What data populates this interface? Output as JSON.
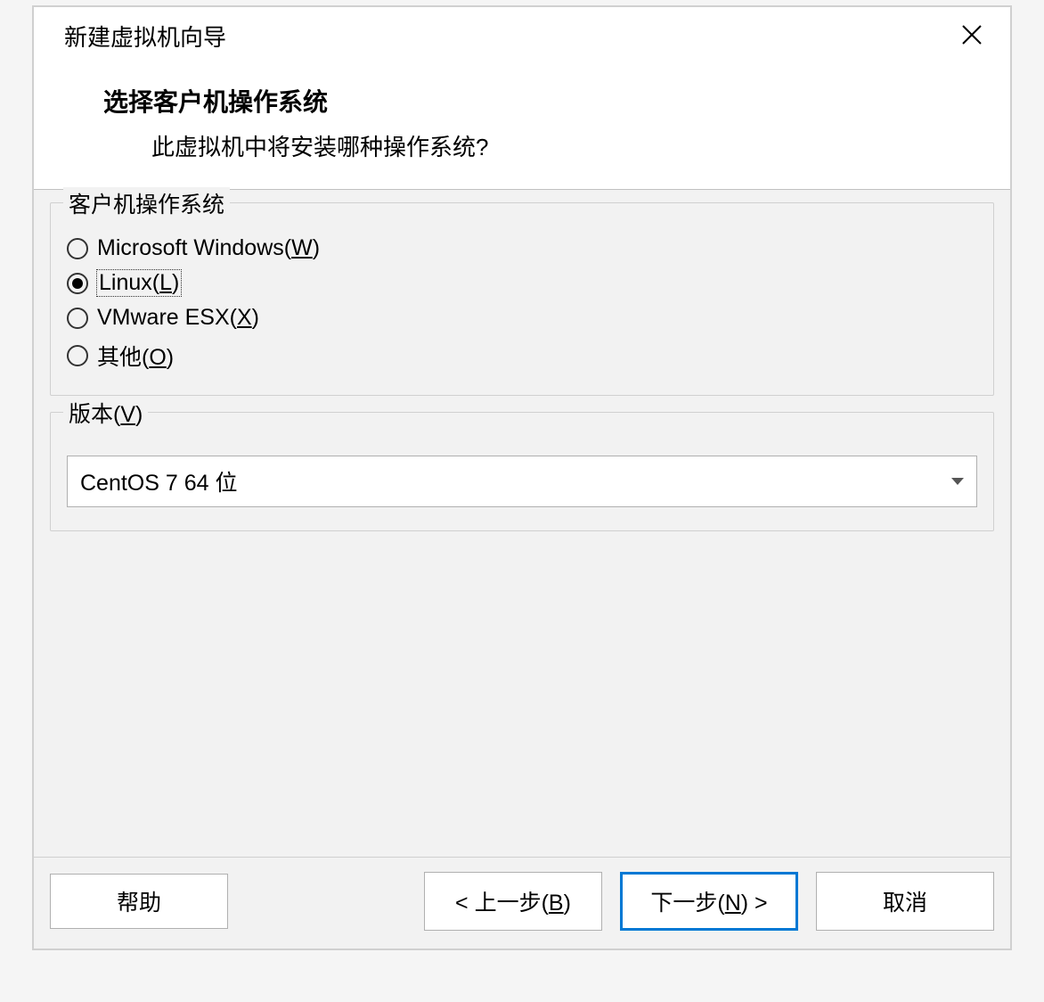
{
  "dialog": {
    "title": "新建虚拟机向导"
  },
  "header": {
    "title": "选择客户机操作系统",
    "subtitle": "此虚拟机中将安装哪种操作系统?"
  },
  "os_group": {
    "legend": "客户机操作系统",
    "options": [
      {
        "prefix": "Microsoft Windows(",
        "key": "W",
        "suffix": ")",
        "checked": false,
        "focused": false
      },
      {
        "prefix": "Linux(",
        "key": "L",
        "suffix": ")",
        "checked": true,
        "focused": true
      },
      {
        "prefix": "VMware ESX(",
        "key": "X",
        "suffix": ")",
        "checked": false,
        "focused": false
      },
      {
        "prefix": "其他(",
        "key": "O",
        "suffix": ")",
        "checked": false,
        "focused": false
      }
    ]
  },
  "version_group": {
    "legend_prefix": "版本(",
    "legend_key": "V",
    "legend_suffix": ")",
    "selected": "CentOS 7 64 位"
  },
  "buttons": {
    "help": "帮助",
    "back_prefix": "< 上一步(",
    "back_key": "B",
    "back_suffix": ")",
    "next_prefix": "下一步(",
    "next_key": "N",
    "next_suffix": ") >",
    "cancel": "取消"
  }
}
